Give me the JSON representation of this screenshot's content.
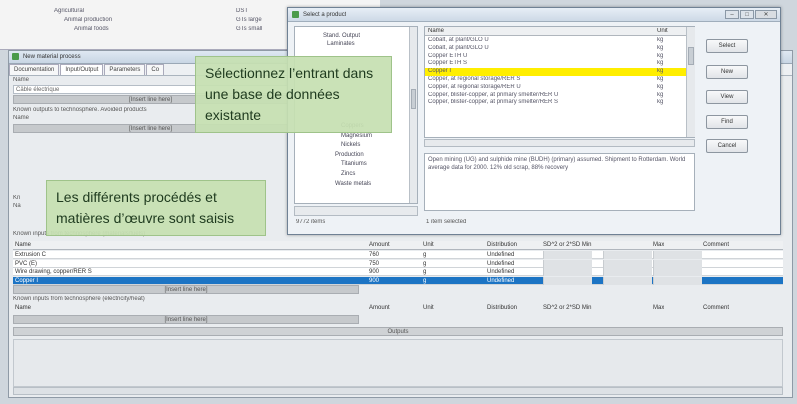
{
  "back_window": {
    "tree": [
      "Agricultural",
      "Animal production",
      "Animal foods"
    ],
    "col2": [
      "DST",
      "GTs large",
      "GTs small"
    ]
  },
  "main_window": {
    "title": "New material process",
    "tabs": [
      "Documentation",
      "Input/Output",
      "Parameters",
      "Co"
    ],
    "name_label": "Name",
    "name_value": "Câble électrique",
    "drag_hint": "[Insert line here]",
    "sec_avoided": "Known outputs to technosphere. Avoided products",
    "sec_material": "Known inputs from technosphere (materials/fuels)",
    "sec_electricity": "Known inputs from technosphere (electricity/heat)",
    "columns": [
      "Name",
      "Amount",
      "Unit",
      "Distribution",
      "SD^2 or 2*SD Min",
      "Max",
      "Comment"
    ],
    "rows": [
      {
        "name": "Extrusion C",
        "amount": "760",
        "unit": "g",
        "dist": "Undefined"
      },
      {
        "name": "PVC (E)",
        "amount": "750",
        "unit": "g",
        "dist": "Undefined"
      },
      {
        "name": "Wire drawing, copper/RER S",
        "amount": "900",
        "unit": "g",
        "dist": "Undefined"
      },
      {
        "name": "Copper I",
        "amount": "900",
        "unit": "g",
        "dist": "Undefined"
      }
    ],
    "outputs_button": "Outputs"
  },
  "dialog": {
    "title": "Select a product",
    "tree": [
      "Stand. Output",
      "Laminates",
      "Coppers",
      "Magnesium",
      "Nickels",
      "Production",
      "Titaniums",
      "Zincs",
      "Waste metals"
    ],
    "tree_count": "9772 items",
    "list_columns": [
      "Name",
      "Unit"
    ],
    "list_items": [
      {
        "name": "Cobalt, at plant/GLO U",
        "unit": "kg"
      },
      {
        "name": "Cobalt, at plant/GLO U",
        "unit": "kg"
      },
      {
        "name": "Copper ETH U",
        "unit": "kg"
      },
      {
        "name": "Copper ETH S",
        "unit": "kg"
      },
      {
        "name": "Copper I",
        "unit": "kg"
      },
      {
        "name": "Copper, at regional storage/RER S",
        "unit": "kg"
      },
      {
        "name": "Copper, at regional storage/RER U",
        "unit": "kg"
      },
      {
        "name": "Copper, blister-copper, at primary smelter/RER U",
        "unit": "kg"
      },
      {
        "name": "Copper, blister-copper, at primary smelter/RER S",
        "unit": "kg"
      }
    ],
    "description": "Open mining (UG) and sulphide mine (BUDH) (primary) assumed. Shipment to Rotterdam. World average data for 2000. 12% old scrap, 88% recovery",
    "status": "1 item selected",
    "buttons": [
      "Select",
      "New",
      "View",
      "Find",
      "Cancel"
    ]
  },
  "callouts": {
    "top": "Sélectionnez l’entrant dans une base de données existante",
    "bottom": "Les différents procédés et matières d’œuvre sont saisis"
  }
}
